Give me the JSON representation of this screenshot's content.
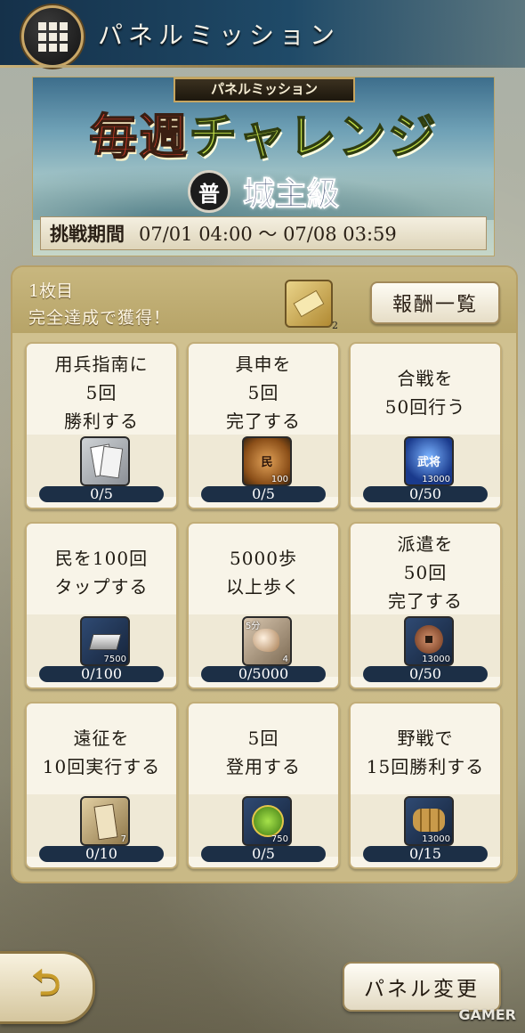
{
  "header": {
    "title": "パネルミッション"
  },
  "banner": {
    "tag": "パネルミッション",
    "title_part1": "毎週",
    "title_part2": "チャレンジ",
    "rank_badge": "普",
    "rank": "城主級",
    "period_label": "挑戦期間",
    "period_value": "07/01 04:00 ～ 07/08 03:59"
  },
  "panel": {
    "sheet_label": "1枚目",
    "reward_label": "完全達成で獲得！",
    "reward_count": "2",
    "reward_list_button": "報酬一覧"
  },
  "missions": [
    {
      "lines": [
        "用兵指南に",
        "5回",
        "勝利する"
      ],
      "icon": "ticket-icon",
      "icon_text": "",
      "qty": "",
      "progress": "0/5"
    },
    {
      "lines": [
        "具申を",
        "5回",
        "完了する"
      ],
      "icon": "bronze-medal-icon",
      "icon_text": "民",
      "qty": "100",
      "progress": "0/5"
    },
    {
      "lines": [
        "合戦を",
        "50回行う"
      ],
      "icon": "blue-orb-icon",
      "icon_text": "武将",
      "qty": "13000",
      "progress": "0/50"
    },
    {
      "lines": [
        "民を100回",
        "タップする"
      ],
      "icon": "silver-ingot-icon",
      "icon_text": "",
      "qty": "7500",
      "progress": "0/100"
    },
    {
      "lines": [
        "5000歩",
        "以上歩く"
      ],
      "icon": "conch-shell-icon",
      "icon_text": "5分",
      "qty": "4",
      "progress": "0/5000"
    },
    {
      "lines": [
        "派遣を",
        "50回",
        "完了する"
      ],
      "icon": "coin-icon",
      "icon_text": "",
      "qty": "13000",
      "progress": "0/50"
    },
    {
      "lines": [
        "遠征を",
        "10回実行する"
      ],
      "icon": "horse-tag-icon",
      "icon_text": "",
      "qty": "7",
      "progress": "0/10"
    },
    {
      "lines": [
        "5回",
        "登用する"
      ],
      "icon": "green-seal-icon",
      "icon_text": "",
      "qty": "750",
      "progress": "0/5"
    },
    {
      "lines": [
        "野戦で",
        "15回勝利する"
      ],
      "icon": "rice-bales-icon",
      "icon_text": "",
      "qty": "13000",
      "progress": "0/15"
    }
  ],
  "footer": {
    "back_icon": "back-arrow-icon",
    "change_panel_button": "パネル変更",
    "watermark": "GAMER"
  }
}
